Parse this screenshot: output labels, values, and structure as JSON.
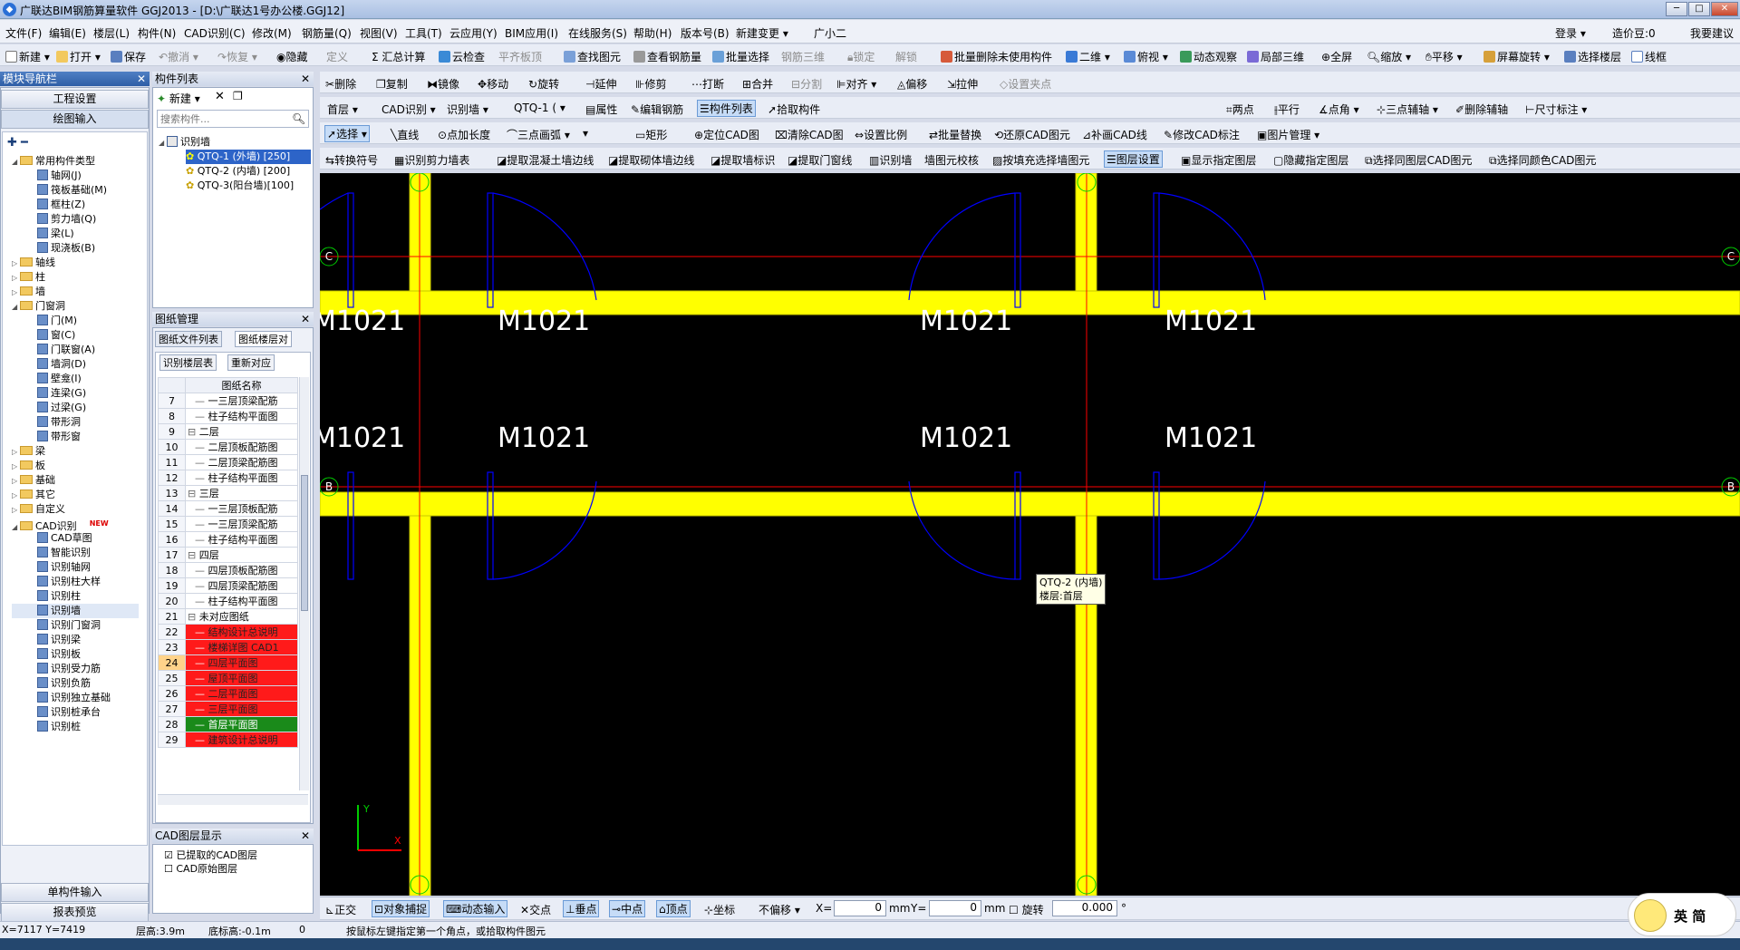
{
  "window": {
    "title": "广联达BIM钢筋算量软件 GGJ2013 - [D:\\广联达1号办公楼.GGJ12]",
    "min": "─",
    "max": "□",
    "close": "✕"
  },
  "menu": [
    "文件(F)",
    "编辑(E)",
    "楼层(L)",
    "构件(N)",
    "CAD识别(C)",
    "修改(M)",
    "钢筋量(Q)",
    "视图(V)",
    "工具(T)",
    "云应用(Y)",
    "BIM应用(I)",
    "在线服务(S)",
    "帮助(H)",
    "版本号(B)",
    "新建变更 ▾",
    "广小二"
  ],
  "menu_right": {
    "login": "登录 ▾",
    "price": "造价豆:0",
    "suggest": "我要建议"
  },
  "toolbar1": [
    "新建 ▾",
    "打开 ▾",
    "保存",
    "撤消 ▾",
    "恢复 ▾",
    "隐藏",
    "定义",
    "Σ 汇总计算",
    "云检查",
    "平齐板顶",
    "查找图元",
    "查看钢筋量",
    "批量选择",
    "钢筋三维",
    "锁定",
    "解锁",
    "批量删除未使用构件",
    "二维 ▾",
    "俯视 ▾",
    "动态观察",
    "局部三维",
    "全屏",
    "缩放 ▾",
    "平移 ▾",
    "屏幕旋转 ▾",
    "选择楼层",
    "线框"
  ],
  "module_nav": {
    "title": "模块导航栏",
    "btn_project": "工程设置",
    "btn_draw": "绘图输入",
    "btn_single": "单构件输入",
    "btn_report": "报表预览"
  },
  "nav_tree": [
    {
      "t": "常用构件类型",
      "lvl": 0,
      "exp": "◢",
      "folder": true
    },
    {
      "t": "轴网(J)",
      "lvl": 1
    },
    {
      "t": "筏板基础(M)",
      "lvl": 1
    },
    {
      "t": "框柱(Z)",
      "lvl": 1
    },
    {
      "t": "剪力墙(Q)",
      "lvl": 1
    },
    {
      "t": "梁(L)",
      "lvl": 1
    },
    {
      "t": "现浇板(B)",
      "lvl": 1
    },
    {
      "t": "轴线",
      "lvl": 0,
      "exp": "▷",
      "folder": true
    },
    {
      "t": "柱",
      "lvl": 0,
      "exp": "▷",
      "folder": true
    },
    {
      "t": "墙",
      "lvl": 0,
      "exp": "▷",
      "folder": true
    },
    {
      "t": "门窗洞",
      "lvl": 0,
      "exp": "◢",
      "folder": true
    },
    {
      "t": "门(M)",
      "lvl": 1
    },
    {
      "t": "窗(C)",
      "lvl": 1
    },
    {
      "t": "门联窗(A)",
      "lvl": 1
    },
    {
      "t": "墙洞(D)",
      "lvl": 1
    },
    {
      "t": "壁龛(I)",
      "lvl": 1
    },
    {
      "t": "连梁(G)",
      "lvl": 1
    },
    {
      "t": "过梁(G)",
      "lvl": 1
    },
    {
      "t": "带形洞",
      "lvl": 1
    },
    {
      "t": "带形窗",
      "lvl": 1
    },
    {
      "t": "梁",
      "lvl": 0,
      "exp": "▷",
      "folder": true
    },
    {
      "t": "板",
      "lvl": 0,
      "exp": "▷",
      "folder": true
    },
    {
      "t": "基础",
      "lvl": 0,
      "exp": "▷",
      "folder": true
    },
    {
      "t": "其它",
      "lvl": 0,
      "exp": "▷",
      "folder": true
    },
    {
      "t": "自定义",
      "lvl": 0,
      "exp": "▷",
      "folder": true
    },
    {
      "t": "CAD识别",
      "lvl": 0,
      "exp": "◢",
      "folder": true,
      "badge": "NEW"
    },
    {
      "t": "CAD草图",
      "lvl": 1
    },
    {
      "t": "智能识别",
      "lvl": 1
    },
    {
      "t": "识别轴网",
      "lvl": 1
    },
    {
      "t": "识别柱大样",
      "lvl": 1
    },
    {
      "t": "识别柱",
      "lvl": 1
    },
    {
      "t": "识别墙",
      "lvl": 1,
      "sel": true
    },
    {
      "t": "识别门窗洞",
      "lvl": 1
    },
    {
      "t": "识别梁",
      "lvl": 1
    },
    {
      "t": "识别板",
      "lvl": 1
    },
    {
      "t": "识别受力筋",
      "lvl": 1
    },
    {
      "t": "识别负筋",
      "lvl": 1
    },
    {
      "t": "识别独立基础",
      "lvl": 1
    },
    {
      "t": "识别桩承台",
      "lvl": 1
    },
    {
      "t": "识别桩",
      "lvl": 1
    }
  ],
  "component_list": {
    "title": "构件列表",
    "new": "新建 ▾",
    "search_placeholder": "搜索构件...",
    "root": "识别墙",
    "items": [
      "QTQ-1 (外墙) [250]",
      "QTQ-2 (内墙) [200]",
      "QTQ-3(阳台墙)[100]"
    ]
  },
  "drawing_mgmt": {
    "title": "图纸管理",
    "tab1": "图纸文件列表",
    "tab2": "图纸楼层对",
    "btn1": "识别楼层表",
    "btn2": "重新对应",
    "col": "图纸名称",
    "rows": [
      {
        "n": "7",
        "t": "一三层顶梁配筋",
        "c": ""
      },
      {
        "n": "8",
        "t": "柱子结构平面图",
        "c": ""
      },
      {
        "n": "9",
        "t": "二层",
        "c": "",
        "grp": true
      },
      {
        "n": "10",
        "t": "二层顶板配筋图",
        "c": ""
      },
      {
        "n": "11",
        "t": "二层顶梁配筋图",
        "c": ""
      },
      {
        "n": "12",
        "t": "柱子结构平面图",
        "c": ""
      },
      {
        "n": "13",
        "t": "三层",
        "c": "",
        "grp": true
      },
      {
        "n": "14",
        "t": "一三层顶板配筋",
        "c": ""
      },
      {
        "n": "15",
        "t": "一三层顶梁配筋",
        "c": ""
      },
      {
        "n": "16",
        "t": "柱子结构平面图",
        "c": ""
      },
      {
        "n": "17",
        "t": "四层",
        "c": "",
        "grp": true
      },
      {
        "n": "18",
        "t": "四层顶板配筋图",
        "c": ""
      },
      {
        "n": "19",
        "t": "四层顶梁配筋图",
        "c": ""
      },
      {
        "n": "20",
        "t": "柱子结构平面图",
        "c": ""
      },
      {
        "n": "21",
        "t": "未对应图纸",
        "c": "",
        "grp": true
      },
      {
        "n": "22",
        "t": "结构设计总说明",
        "c": "red"
      },
      {
        "n": "23",
        "t": "楼梯详图 CAD1",
        "c": "red"
      },
      {
        "n": "24",
        "t": "四层平面图",
        "c": "red",
        "hl": true
      },
      {
        "n": "25",
        "t": "屋顶平面图",
        "c": "red"
      },
      {
        "n": "26",
        "t": "二层平面图",
        "c": "red"
      },
      {
        "n": "27",
        "t": "三层平面图",
        "c": "red"
      },
      {
        "n": "28",
        "t": "首层平面图",
        "c": "green"
      },
      {
        "n": "29",
        "t": "建筑设计总说明",
        "c": "red"
      }
    ]
  },
  "cad_layers": {
    "title": "CAD图层显示",
    "item1": "已提取的CAD图层",
    "item2": "CAD原始图层"
  },
  "toolbar_edit": [
    "删除",
    "复制",
    "镜像",
    "移动",
    "旋转",
    "延伸",
    "修剪",
    "打断",
    "合并",
    "分割",
    "对齐 ▾",
    "偏移",
    "拉伸",
    "设置夹点"
  ],
  "toolbar_floor": {
    "floor": "首层",
    "cad": "CAD识别",
    "wall": "识别墙",
    "comp": "QTQ-1 (",
    "attr": "属性",
    "edit_rebar": "编辑钢筋",
    "list": "构件列表",
    "pick": "拾取构件",
    "two_point": "两点",
    "parallel": "平行",
    "angle": "点角 ▾",
    "three_axis": "三点辅轴 ▾",
    "del_axis": "删除辅轴",
    "dim": "尺寸标注 ▾"
  },
  "toolbar_draw": {
    "select": "选择",
    "line": "直线",
    "point_len": "点加长度",
    "arc": "三点画弧",
    "rect": "矩形",
    "locate": "定位CAD图",
    "clear": "清除CAD图",
    "scale": "设置比例",
    "replace": "批量替换",
    "restore": "还原CAD图元",
    "fill": "补画CAD线",
    "modify": "修改CAD标注",
    "pic": "图片管理 ▾"
  },
  "toolbar_cad": [
    "转换符号",
    "识别剪力墙表",
    "提取混凝土墙边线",
    "提取砌体墙边线",
    "提取墙标识",
    "提取门窗线",
    "识别墙",
    "墙图元校核",
    "按填充选择墙图元",
    "图层设置",
    "显示指定图层",
    "隐藏指定图层",
    "选择同图层CAD图元",
    "选择同颜色CAD图元"
  ],
  "canvas": {
    "door_labels": [
      "M1021",
      "M1021",
      "M1021",
      "M1021",
      "M1021",
      "M1021",
      "M1021",
      "M1021"
    ],
    "axis_labels": [
      "C",
      "C",
      "B",
      "B"
    ],
    "tooltip": {
      "line1": "QTQ-2 (内墙)",
      "line2": "楼层:首层"
    },
    "axis_y": "Y",
    "axis_x": "X",
    "colors": {
      "wall": "#ffff00",
      "axis": "#ff0000",
      "door": "#0000ff",
      "text": "#ffffff",
      "grid": "#00ff00"
    }
  },
  "snap_bar": {
    "ortho": "正交",
    "obj_snap": "对象捕捉",
    "dyn_input": "动态输入",
    "intersect": "交点",
    "perp": "垂点",
    "mid": "中点",
    "vertex": "顶点",
    "coord": "坐标",
    "offset": "不偏移",
    "x_label": "X=",
    "x_val": "0",
    "x_unit": "mm",
    "y_label": "Y=",
    "y_val": "0",
    "y_unit": "mm",
    "rotate": "旋转",
    "rot_val": "0.000",
    "deg": "°"
  },
  "status": {
    "coords": "X=7117 Y=7419",
    "floor_h": "层高:3.9m",
    "base_h": "底标高:-0.1m",
    "zero": "0",
    "hint": "按鼠标左键指定第一个角点，或拾取构件图元"
  },
  "ime": {
    "label": "英 简"
  }
}
